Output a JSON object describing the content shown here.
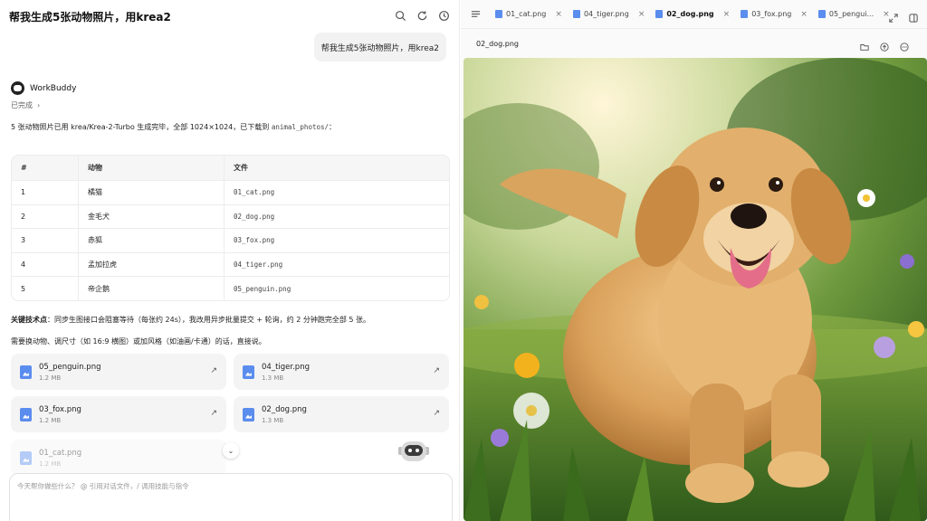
{
  "chat": {
    "title": "帮我生成5张动物照片，用krea2",
    "user_message": "帮我生成5张动物照片，用krea2",
    "bot_name": "WorkBuddy",
    "status": "已完成",
    "summary_text": "5 张动物照片已用 krea/Krea-2-Turbo 生成完毕，全部 1024×1024，已下载到 ",
    "summary_path": "animal_photos/",
    "summary_end": "：",
    "table": {
      "headers": [
        "#",
        "动物",
        "文件"
      ],
      "rows": [
        [
          "1",
          "橘猫",
          "01_cat.png"
        ],
        [
          "2",
          "金毛犬",
          "02_dog.png"
        ],
        [
          "3",
          "赤狐",
          "03_fox.png"
        ],
        [
          "4",
          "孟加拉虎",
          "04_tiger.png"
        ],
        [
          "5",
          "帝企鹅",
          "05_penguin.png"
        ]
      ]
    },
    "key_label": "关键技术点",
    "key_text": "：同步生图接口会阻塞等待（每张约 24s），我改用异步批量提交 + 轮询，约 2 分钟跑完全部 5 张。",
    "followup": "需要换动物、调尺寸（如 16:9 横图）或加风格（如油画/卡通）的话，直接说。",
    "files": [
      {
        "name": "05_penguin.png",
        "size": "1.2 MB"
      },
      {
        "name": "04_tiger.png",
        "size": "1.3 MB"
      },
      {
        "name": "03_fox.png",
        "size": "1.2 MB"
      },
      {
        "name": "02_dog.png",
        "size": "1.3 MB"
      },
      {
        "name": "01_cat.png",
        "size": "1.2 MB"
      }
    ],
    "composer_placeholder": "今天帮你做些什么？ @ 引用对话文件，/ 调用技能与指令"
  },
  "preview": {
    "tabs": [
      {
        "label": "01_cat.png",
        "active": false
      },
      {
        "label": "04_tiger.png",
        "active": false
      },
      {
        "label": "02_dog.png",
        "active": true
      },
      {
        "label": "03_fox.png",
        "active": false
      },
      {
        "label": "05_pengui...",
        "active": false
      }
    ],
    "current_file": "02_dog.png"
  },
  "colors": {
    "accent": "#5b8def",
    "bubble": "#f2f2f2",
    "card": "#f4f4f4"
  },
  "icons": [
    "search-icon",
    "refresh-icon",
    "clock-icon",
    "menu-icon",
    "close-icon",
    "expand-icon",
    "split-icon",
    "folder-icon",
    "upload-icon",
    "more-icon",
    "external-link-icon",
    "chevron-down-icon",
    "chevron-right-icon"
  ]
}
